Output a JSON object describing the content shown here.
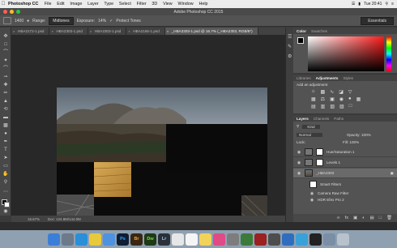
{
  "menubar": {
    "app_name": "Photoshop CC",
    "items": [
      "File",
      "Edit",
      "Image",
      "Layer",
      "Type",
      "Select",
      "Filter",
      "3D",
      "View",
      "Window",
      "Help"
    ],
    "clock": "Tue 20:41"
  },
  "window": {
    "title": "Adobe Photoshop CC 2015"
  },
  "options": {
    "brush_size": "1400",
    "range_label": "Range:",
    "range_value": "Midtones",
    "exposure_label": "Exposure:",
    "exposure_value": "14%",
    "protect_tones": "Protect Tones",
    "workspace": "Essentials"
  },
  "tabs": [
    "HBA2172-1.psd",
    "HBA2303-1.psd",
    "HBA2303-1.psd",
    "HBA2166-1.psd",
    "_HBA2303-1.psd @ 16.7% (_HBA2303, RGB/8*)"
  ],
  "status": {
    "zoom": "16.67%",
    "doc": "Doc: 124.8M/144.0M"
  },
  "color_panel": {
    "tabs": [
      "Color",
      "Swatches"
    ]
  },
  "adjust_panel": {
    "tabs": [
      "Libraries",
      "Adjustments",
      "Styles"
    ],
    "hint": "Add an adjustment"
  },
  "layers_panel": {
    "tabs": [
      "Layers",
      "Channels",
      "Paths"
    ],
    "kind": "Kind",
    "blend": "Normal",
    "opacity_label": "Opacity:",
    "opacity": "100%",
    "lock_label": "Lock:",
    "fill_label": "Fill:",
    "fill": "100%",
    "layers": [
      {
        "name": "Hue/Saturation 1"
      },
      {
        "name": "Levels 1"
      },
      {
        "name": "_HBA2303"
      }
    ],
    "smart_filters_label": "Smart Filters",
    "filters": [
      "Camera Raw Filter",
      "HDR Efex Pro 2"
    ]
  },
  "dock": [
    {
      "icon": "finder-icon",
      "label": "",
      "color": "#3b7ed8"
    },
    {
      "icon": "launchpad-icon",
      "label": "",
      "color": "#6c7a8a"
    },
    {
      "icon": "safari-icon",
      "label": "",
      "color": "#2a8fd8"
    },
    {
      "icon": "chrome-icon",
      "label": "",
      "color": "#e8c93a"
    },
    {
      "icon": "mail-icon",
      "label": "",
      "color": "#4e92e0"
    },
    {
      "icon": "photoshop-icon",
      "label": "Ps",
      "color": "#0f1e33"
    },
    {
      "icon": "bridge-icon",
      "label": "Br",
      "color": "#3a2713"
    },
    {
      "icon": "dreamweaver-icon",
      "label": "Dw",
      "color": "#1f3a14"
    },
    {
      "icon": "lightroom-icon",
      "label": "Lr",
      "color": "#2b3038"
    },
    {
      "icon": "photos-icon",
      "label": "",
      "color": "#e6e6e6"
    },
    {
      "icon": "calendar-icon",
      "label": "",
      "color": "#f5f5f5"
    },
    {
      "icon": "notes-icon",
      "label": "",
      "color": "#f2d35a"
    },
    {
      "icon": "itunes-icon",
      "label": "",
      "color": "#e04a87"
    },
    {
      "icon": "settings-icon",
      "label": "",
      "color": "#7d7d7d"
    },
    {
      "icon": "app-icon",
      "label": "",
      "color": "#3b7a3b"
    },
    {
      "icon": "app-icon-2",
      "label": "",
      "color": "#9b2020"
    },
    {
      "icon": "app-icon-3",
      "label": "",
      "color": "#4d4d4d"
    },
    {
      "icon": "app-icon-4",
      "label": "",
      "color": "#2f6ebf"
    },
    {
      "icon": "app-icon-5",
      "label": "",
      "color": "#3aa0d8"
    },
    {
      "icon": "app-icon-6",
      "label": "",
      "color": "#222"
    },
    {
      "icon": "downloads-icon",
      "label": "",
      "color": "#7a8fa5"
    },
    {
      "icon": "trash-icon",
      "label": "",
      "color": "#b8c2cc"
    }
  ]
}
